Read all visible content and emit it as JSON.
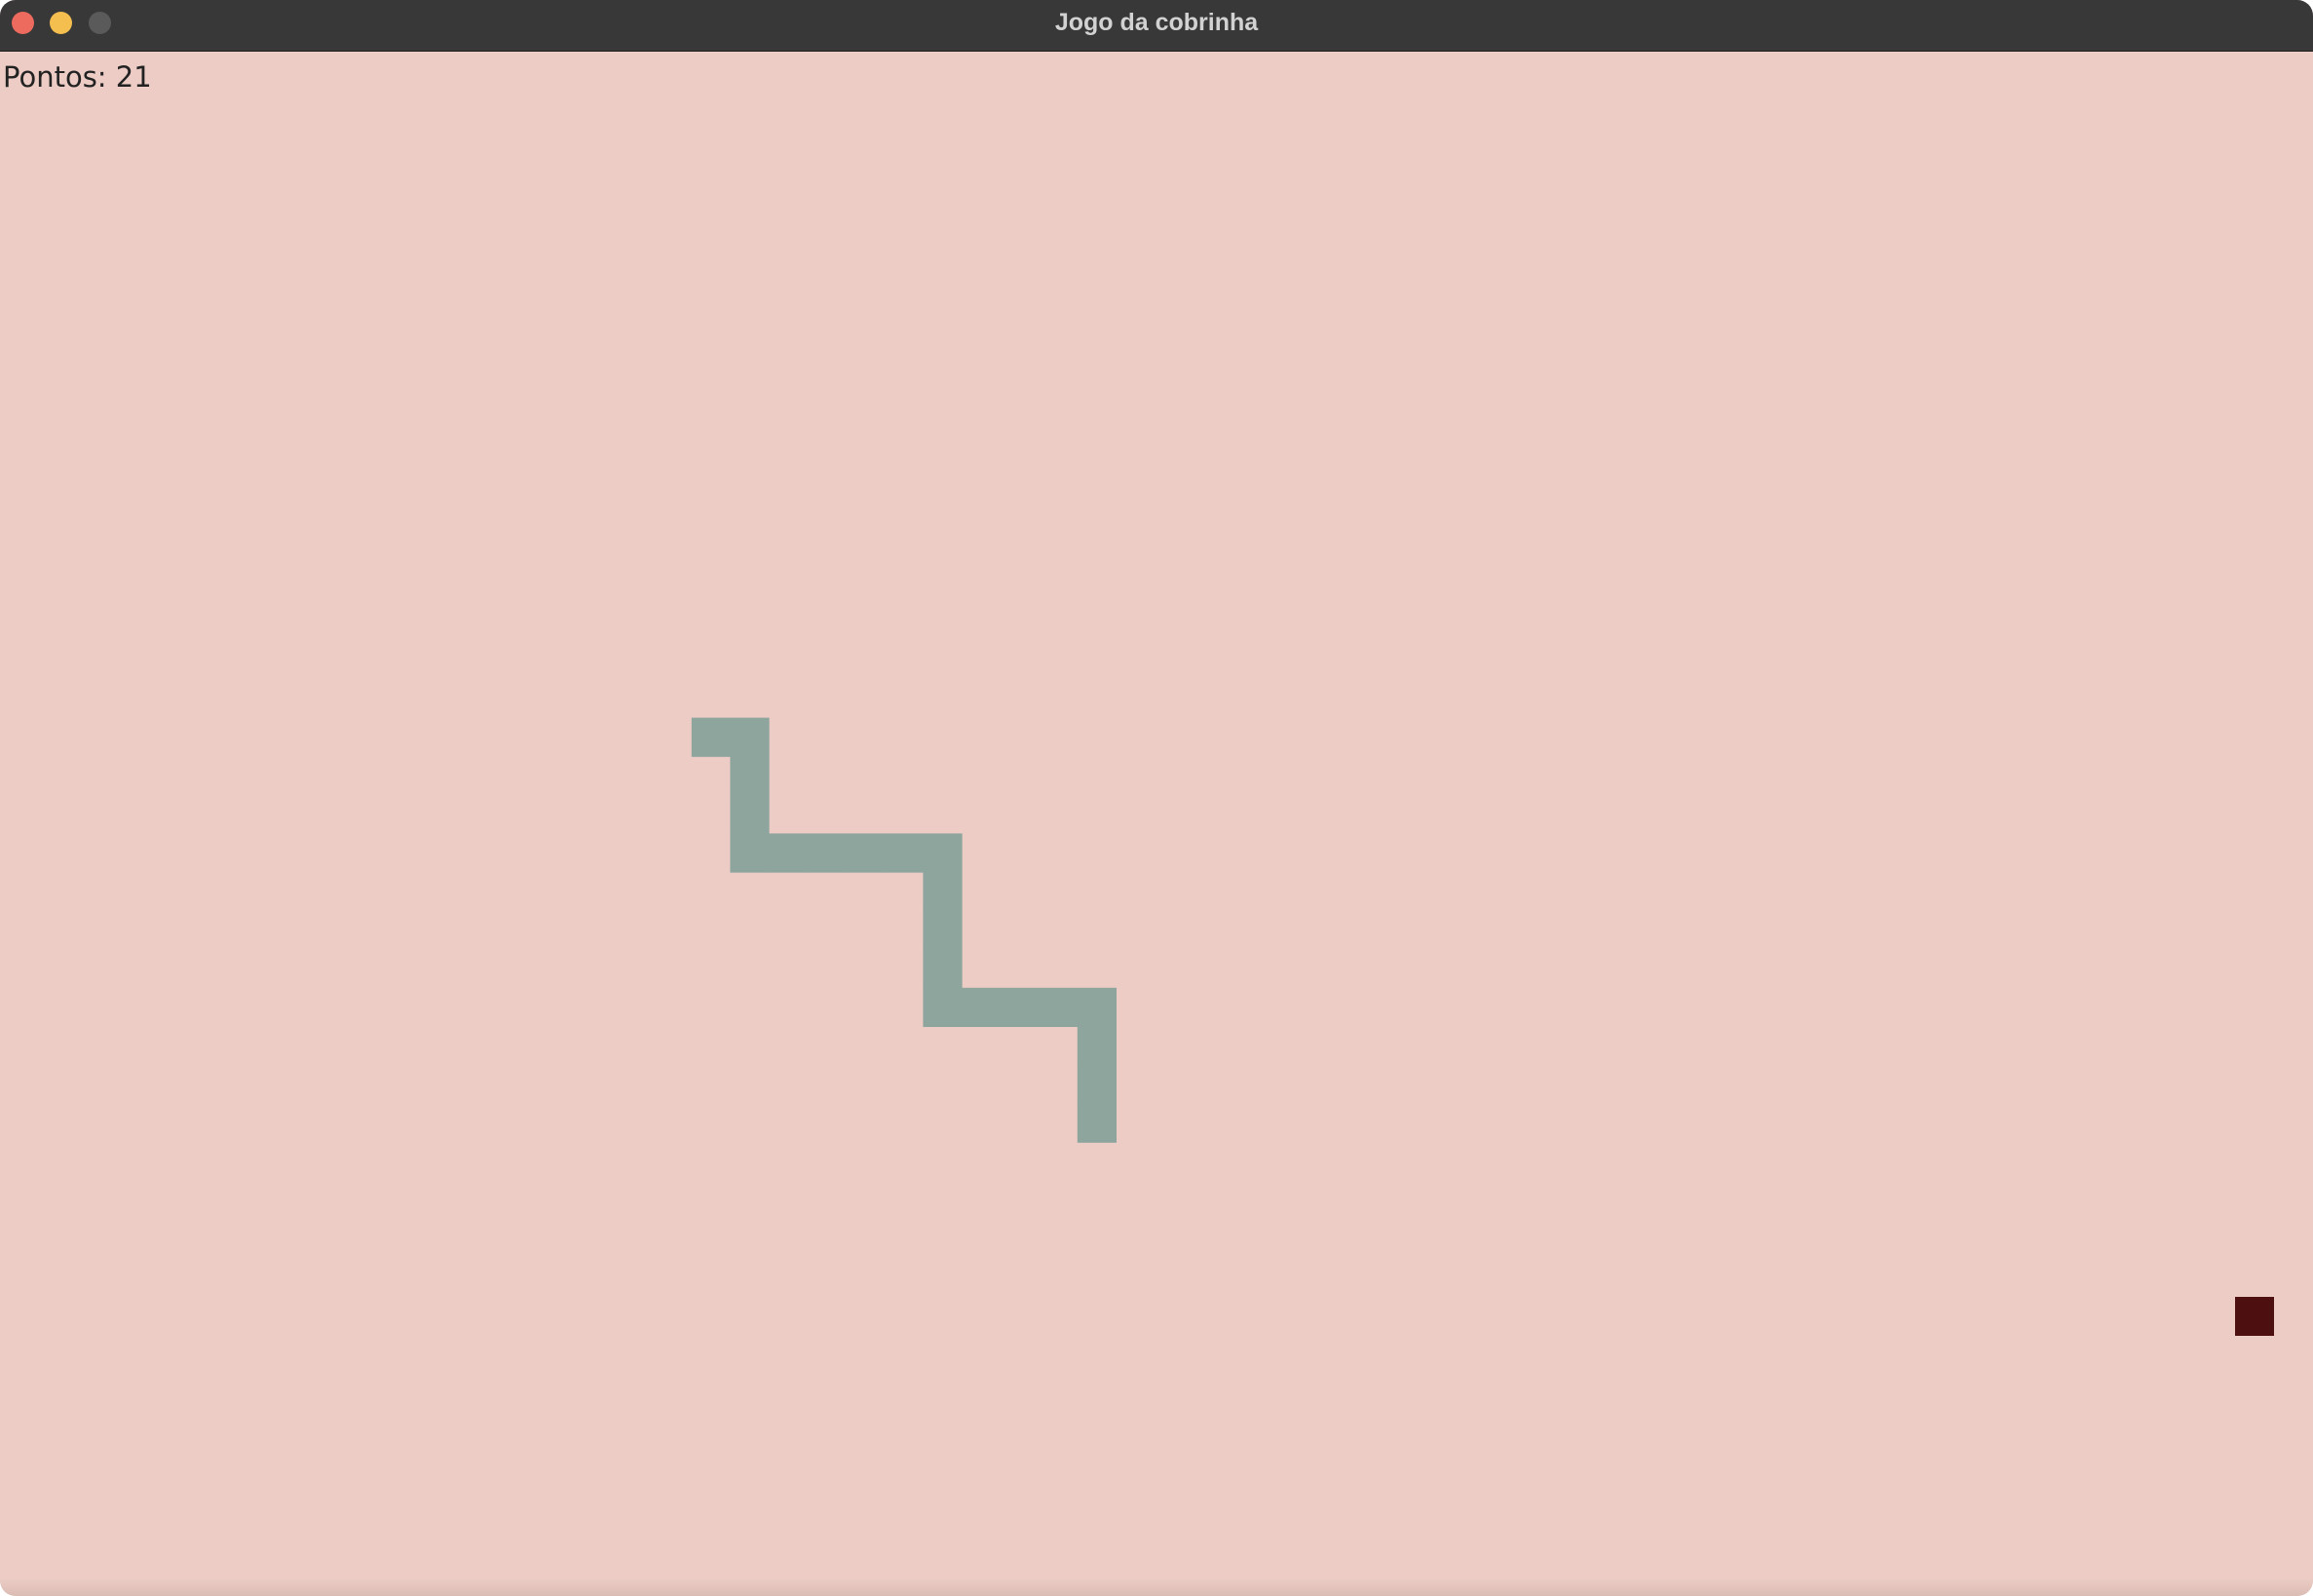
{
  "window": {
    "title": "Jogo da cobrinha"
  },
  "game": {
    "score_text": "Pontos: 21",
    "colors": {
      "background": "#ecccc4",
      "snake": "#8ea59e",
      "food": "#4e0f10"
    },
    "grid_cell_count": {
      "columns": 60,
      "rows": 41
    },
    "snake_cells": [
      [
        18,
        16
      ],
      [
        19,
        16
      ],
      [
        19,
        17
      ],
      [
        19,
        18
      ],
      [
        19,
        19
      ],
      [
        20,
        19
      ],
      [
        21,
        19
      ],
      [
        22,
        19
      ],
      [
        23,
        19
      ],
      [
        24,
        19
      ],
      [
        24,
        20
      ],
      [
        24,
        21
      ],
      [
        24,
        22
      ],
      [
        24,
        23
      ],
      [
        25,
        23
      ],
      [
        26,
        23
      ],
      [
        27,
        23
      ],
      [
        28,
        23
      ],
      [
        28,
        24
      ],
      [
        28,
        25
      ],
      [
        28,
        26
      ]
    ],
    "food_cell": [
      58,
      31
    ]
  }
}
